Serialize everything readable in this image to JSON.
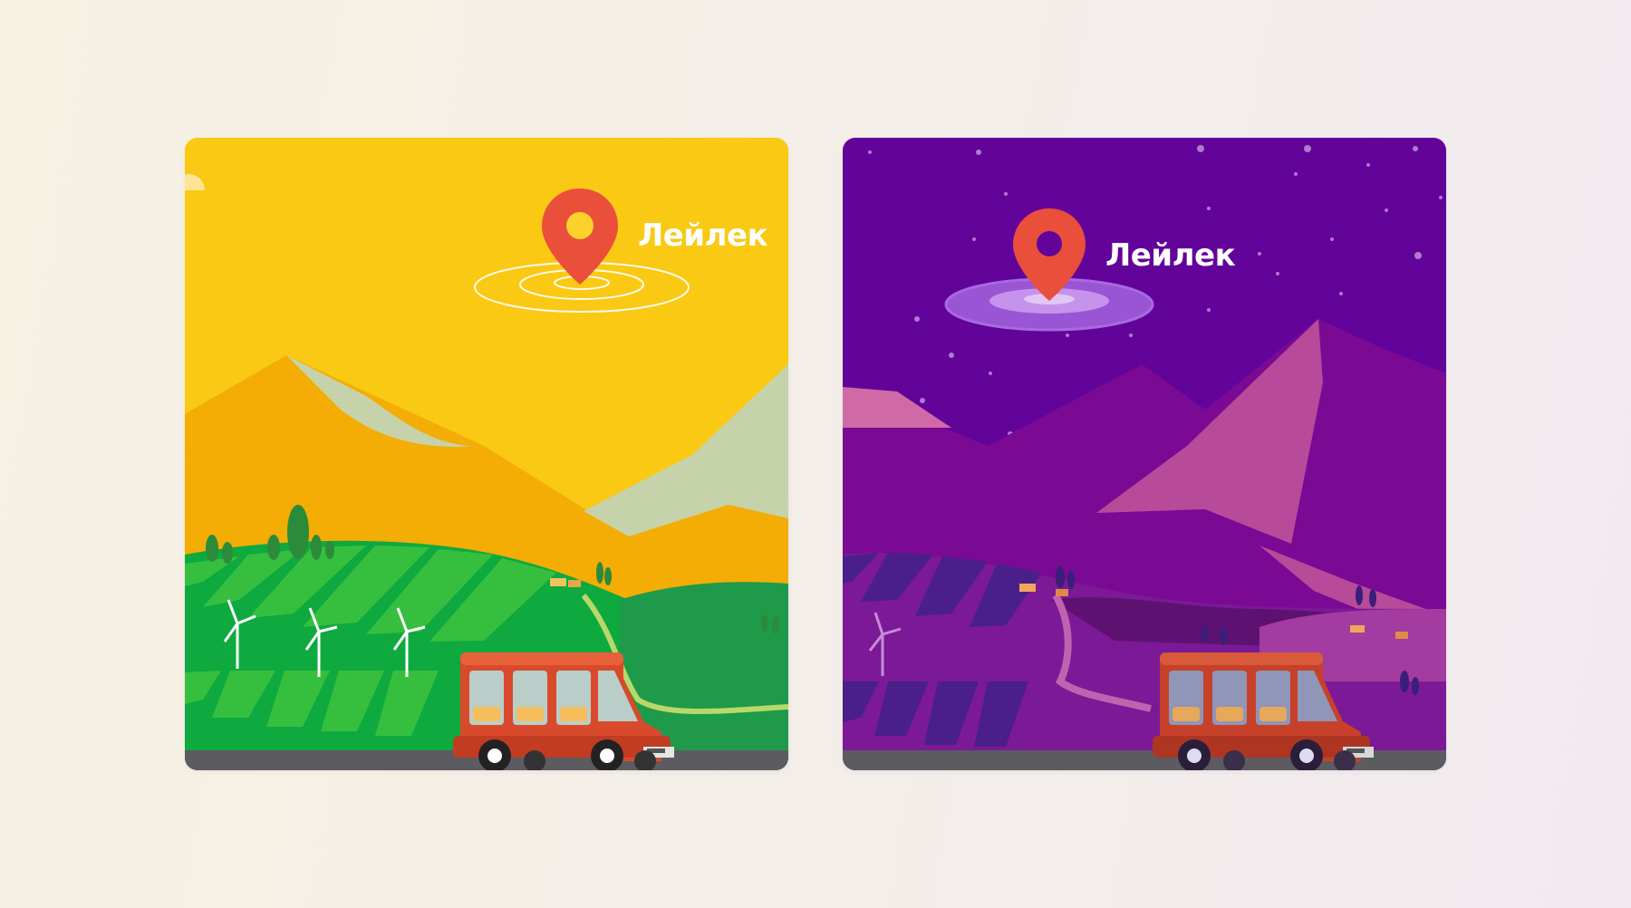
{
  "cards": [
    {
      "theme": "day",
      "brand": "Лейлек",
      "colors": {
        "sky": "#f9c914",
        "mountain": "#f3ad05",
        "snow": "#c6d3aa",
        "field": "#0ea93f",
        "stripe": "#36bf3f",
        "road": "#5b5b60",
        "pin": "#ea4f3c"
      }
    },
    {
      "theme": "night",
      "brand": "Лейлек",
      "colors": {
        "sky": "#62039a",
        "mountain": "#7a0a94",
        "peak": "#b84a9a",
        "field": "#7b1996",
        "stripe": "#4a1f8a",
        "road": "#5b5b60",
        "pin": "#ea4f3c"
      }
    }
  ]
}
